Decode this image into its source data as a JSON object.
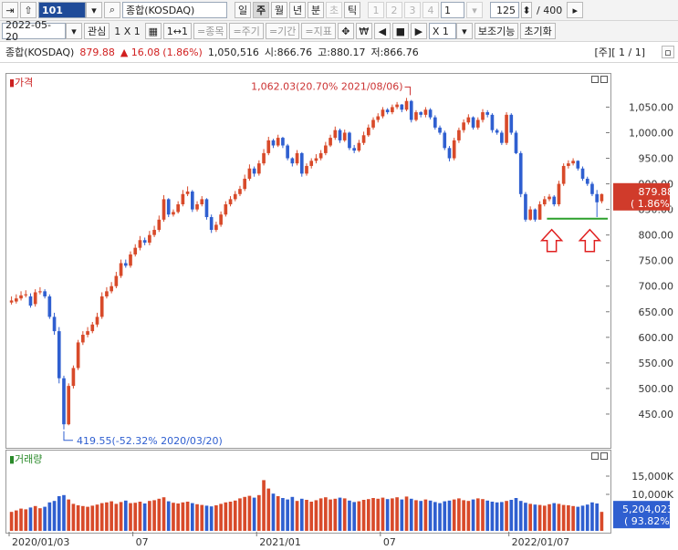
{
  "toolbar1": {
    "code": "101",
    "index_name": "종합(KOSDAQ)",
    "periods": [
      "일",
      "주",
      "월",
      "년",
      "분",
      "초",
      "틱"
    ],
    "active_period": "주",
    "minute_options": [
      "1",
      "2",
      "3",
      "4"
    ],
    "interval_value": "1",
    "count_value": "125",
    "total_count": "/ 400"
  },
  "toolbar2": {
    "date": "2022-05-20",
    "watch_label": "관심",
    "layout_label": "1 X 1",
    "zoom_label": "1↔1",
    "tools": [
      "=종목",
      "=주기",
      "=기간",
      "=지표"
    ],
    "won_label": "₩",
    "multiplier": "X  1",
    "aux_label": "보조기능",
    "reset_label": "초기화"
  },
  "info": {
    "name": "종합(KOSDAQ)",
    "price": "879.88",
    "change": "▲ 16.08",
    "change_pct": "(1.86%)",
    "volume": "1,050,516",
    "open": "시:866.76",
    "high": "고:880.17",
    "low": "저:866.76",
    "page": "[주][ 1 / 1]"
  },
  "panels": {
    "price_title": "▮가격",
    "volume_title": "▮거래량"
  },
  "chart_data": [
    {
      "type": "candlestick",
      "title": "가격",
      "x_ticks": [
        "2020/01/03",
        "07",
        "2021/01",
        "07",
        "2022/01/07"
      ],
      "y_ticks": [
        "1,050.00",
        "1,000.00",
        "950.00",
        "900.00",
        "850.00",
        "800.00",
        "750.00",
        "700.00",
        "650.00",
        "600.00",
        "550.00",
        "500.00",
        "450.00"
      ],
      "ylim": [
        400,
        1090
      ],
      "annotations": {
        "high": "1,062.03(20.70% 2021/08/06)",
        "low": "419.55(-52.32% 2020/03/20)"
      },
      "current_label": "879.88",
      "current_pct": "( 1.86%)",
      "support_line": 832,
      "x": [
        "2020-01-03",
        "2020-01-10",
        "2020-01-17",
        "2020-01-24",
        "2020-01-31",
        "2020-02-07",
        "2020-02-14",
        "2020-02-21",
        "2020-02-28",
        "2020-03-06",
        "2020-03-13",
        "2020-03-20",
        "2020-03-27",
        "2020-04-03",
        "2020-04-10",
        "2020-04-17",
        "2020-04-24",
        "2020-05-01",
        "2020-05-08",
        "2020-05-15",
        "2020-05-22",
        "2020-05-29",
        "2020-06-05",
        "2020-06-12",
        "2020-06-19",
        "2020-06-26",
        "2020-07-03",
        "2020-07-10",
        "2020-07-17",
        "2020-07-24",
        "2020-07-31",
        "2020-08-07",
        "2020-08-14",
        "2020-08-21",
        "2020-08-28",
        "2020-09-04",
        "2020-09-11",
        "2020-09-18",
        "2020-09-25",
        "2020-10-02",
        "2020-10-09",
        "2020-10-16",
        "2020-10-23",
        "2020-10-30",
        "2020-11-06",
        "2020-11-13",
        "2020-11-20",
        "2020-11-27",
        "2020-12-04",
        "2020-12-11",
        "2020-12-18",
        "2020-12-25",
        "2021-01-01",
        "2021-01-08",
        "2021-01-15",
        "2021-01-22",
        "2021-01-29",
        "2021-02-05",
        "2021-02-12",
        "2021-02-19",
        "2021-02-26",
        "2021-03-05",
        "2021-03-12",
        "2021-03-19",
        "2021-03-26",
        "2021-04-02",
        "2021-04-09",
        "2021-04-16",
        "2021-04-23",
        "2021-04-30",
        "2021-05-07",
        "2021-05-14",
        "2021-05-21",
        "2021-05-28",
        "2021-06-04",
        "2021-06-11",
        "2021-06-18",
        "2021-06-25",
        "2021-07-02",
        "2021-07-09",
        "2021-07-16",
        "2021-07-23",
        "2021-07-30",
        "2021-08-06",
        "2021-08-13",
        "2021-08-20",
        "2021-08-27",
        "2021-09-03",
        "2021-09-10",
        "2021-09-17",
        "2021-09-24",
        "2021-10-01",
        "2021-10-08",
        "2021-10-15",
        "2021-10-22",
        "2021-10-29",
        "2021-11-05",
        "2021-11-12",
        "2021-11-19",
        "2021-11-26",
        "2021-12-03",
        "2021-12-10",
        "2021-12-17",
        "2021-12-24",
        "2021-12-31",
        "2022-01-07",
        "2022-01-14",
        "2022-01-21",
        "2022-01-28",
        "2022-02-04",
        "2022-02-11",
        "2022-02-18",
        "2022-02-25",
        "2022-03-04",
        "2022-03-11",
        "2022-03-18",
        "2022-03-25",
        "2022-04-01",
        "2022-04-08",
        "2022-04-15",
        "2022-04-22",
        "2022-04-29",
        "2022-05-06",
        "2022-05-13",
        "2022-05-20"
      ],
      "close": [
        672,
        676,
        682,
        684,
        662,
        688,
        690,
        680,
        640,
        612,
        520,
        430,
        505,
        540,
        590,
        605,
        612,
        625,
        640,
        680,
        690,
        700,
        720,
        745,
        740,
        762,
        775,
        790,
        785,
        800,
        810,
        830,
        870,
        840,
        845,
        860,
        880,
        885,
        850,
        860,
        870,
        835,
        810,
        820,
        840,
        860,
        870,
        880,
        890,
        910,
        930,
        920,
        940,
        960,
        985,
        975,
        990,
        975,
        950,
        940,
        960,
        920,
        935,
        945,
        950,
        960,
        975,
        990,
        1005,
        985,
        1000,
        970,
        965,
        980,
        995,
        1010,
        1025,
        1032,
        1045,
        1040,
        1050,
        1055,
        1045,
        1062,
        1025,
        1040,
        1035,
        1045,
        1030,
        1010,
        1000,
        970,
        950,
        985,
        1005,
        1020,
        1030,
        1010,
        1025,
        1040,
        1035,
        1005,
        1000,
        980,
        1035,
        1000,
        960,
        880,
        830,
        850,
        830,
        860,
        870,
        875,
        860,
        900,
        935,
        940,
        945,
        930,
        910,
        900,
        880,
        864,
        880
      ],
      "open": [
        668,
        670,
        676,
        682,
        680,
        665,
        688,
        690,
        680,
        640,
        612,
        520,
        430,
        505,
        540,
        590,
        605,
        612,
        625,
        640,
        680,
        690,
        700,
        720,
        745,
        740,
        762,
        775,
        790,
        785,
        800,
        810,
        830,
        870,
        840,
        845,
        860,
        880,
        885,
        850,
        860,
        870,
        835,
        810,
        820,
        840,
        860,
        870,
        880,
        890,
        910,
        930,
        920,
        940,
        960,
        985,
        975,
        990,
        975,
        950,
        940,
        960,
        920,
        935,
        945,
        950,
        960,
        975,
        990,
        1005,
        985,
        1000,
        970,
        965,
        980,
        995,
        1010,
        1025,
        1032,
        1045,
        1040,
        1050,
        1055,
        1045,
        1062,
        1025,
        1040,
        1035,
        1045,
        1030,
        1010,
        1000,
        970,
        950,
        985,
        1005,
        1020,
        1030,
        1010,
        1025,
        1040,
        1035,
        1005,
        1000,
        980,
        1035,
        1000,
        960,
        880,
        830,
        850,
        830,
        860,
        870,
        875,
        860,
        900,
        935,
        940,
        945,
        930,
        910,
        900,
        880,
        866
      ],
      "high": [
        680,
        684,
        690,
        692,
        686,
        694,
        698,
        694,
        684,
        648,
        620,
        525,
        510,
        545,
        595,
        612,
        620,
        630,
        648,
        688,
        698,
        708,
        728,
        752,
        752,
        768,
        782,
        798,
        795,
        808,
        818,
        838,
        878,
        872,
        850,
        866,
        888,
        895,
        888,
        866,
        876,
        872,
        840,
        826,
        846,
        866,
        876,
        886,
        896,
        918,
        938,
        934,
        946,
        968,
        992,
        988,
        996,
        992,
        978,
        952,
        966,
        962,
        940,
        950,
        958,
        966,
        982,
        996,
        1012,
        1008,
        1006,
        1002,
        976,
        986,
        1002,
        1016,
        1030,
        1038,
        1050,
        1048,
        1055,
        1060,
        1056,
        1068,
        1064,
        1044,
        1042,
        1050,
        1048,
        1034,
        1014,
        1004,
        974,
        990,
        1010,
        1026,
        1036,
        1032,
        1030,
        1046,
        1044,
        1038,
        1008,
        1004,
        1040,
        1038,
        1004,
        964,
        884,
        856,
        852,
        866,
        876,
        880,
        878,
        906,
        940,
        946,
        950,
        946,
        934,
        914,
        904,
        888,
        881
      ],
      "low": [
        664,
        666,
        672,
        678,
        658,
        660,
        684,
        676,
        636,
        605,
        510,
        420,
        428,
        500,
        536,
        585,
        600,
        608,
        620,
        636,
        676,
        686,
        696,
        716,
        736,
        736,
        758,
        770,
        780,
        780,
        796,
        806,
        826,
        835,
        836,
        842,
        856,
        876,
        845,
        846,
        856,
        830,
        804,
        806,
        816,
        836,
        856,
        866,
        876,
        886,
        906,
        914,
        916,
        936,
        956,
        970,
        972,
        970,
        946,
        934,
        936,
        914,
        916,
        930,
        940,
        946,
        956,
        972,
        986,
        980,
        982,
        966,
        960,
        962,
        976,
        992,
        1006,
        1020,
        1028,
        1036,
        1036,
        1046,
        1040,
        1042,
        1020,
        1022,
        1030,
        1030,
        1026,
        1006,
        996,
        966,
        944,
        946,
        980,
        1000,
        1016,
        1006,
        1006,
        1020,
        1030,
        1000,
        996,
        976,
        976,
        996,
        958,
        874,
        826,
        828,
        826,
        830,
        856,
        866,
        856,
        856,
        896,
        930,
        936,
        926,
        906,
        896,
        876,
        835,
        862
      ]
    },
    {
      "type": "bar",
      "title": "거래량",
      "y_ticks": [
        "15,000K",
        "10,000K"
      ],
      "ylim": [
        0,
        18000
      ],
      "current_label": "5,204,023",
      "current_pct": "( 93.82%)",
      "values": [
        5200,
        5600,
        6100,
        5900,
        6400,
        6800,
        6200,
        6600,
        7800,
        8200,
        9500,
        9800,
        8600,
        7400,
        7000,
        6800,
        6600,
        6900,
        7200,
        7600,
        7800,
        8100,
        7400,
        7900,
        8300,
        7600,
        7700,
        8000,
        7500,
        8200,
        8400,
        8800,
        9200,
        8100,
        7700,
        7500,
        7800,
        8000,
        7600,
        7300,
        7100,
        6900,
        6700,
        7000,
        7400,
        7800,
        8000,
        8300,
        8900,
        9300,
        9600,
        9100,
        9800,
        13900,
        11600,
        10200,
        9500,
        9000,
        8600,
        9300,
        8200,
        8800,
        8500,
        8000,
        8400,
        8900,
        9200,
        8600,
        8800,
        9100,
        8900,
        8300,
        7900,
        8100,
        8500,
        8700,
        9000,
        8800,
        9100,
        8700,
        8900,
        9200,
        8600,
        9400,
        8800,
        8400,
        8200,
        8600,
        8300,
        7900,
        7600,
        8100,
        8300,
        8600,
        8900,
        8400,
        8200,
        8600,
        8900,
        8700,
        8300,
        8000,
        7800,
        7900,
        8200,
        8500,
        9000,
        8200,
        7700,
        7400,
        7200,
        7100,
        6900,
        7300,
        7600,
        7400,
        7100,
        7000,
        6800,
        6600,
        6900,
        7200,
        7800,
        7500,
        5204
      ]
    }
  ]
}
